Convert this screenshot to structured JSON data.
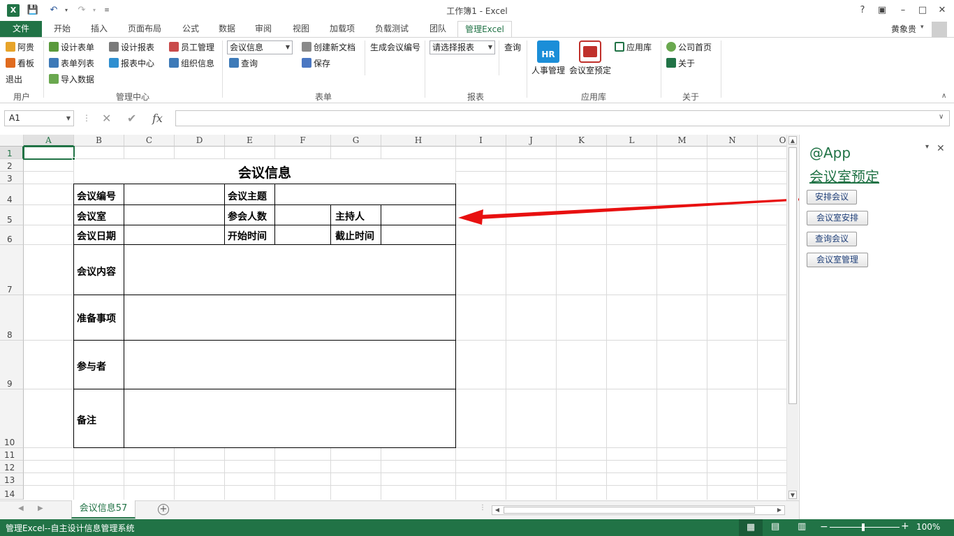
{
  "window": {
    "title": "工作簿1 - Excel",
    "help": "?",
    "user": "黄象贵"
  },
  "tabs": [
    "文件",
    "开始",
    "插入",
    "页面布局",
    "公式",
    "数据",
    "审阅",
    "视图",
    "加载项",
    "负载测试",
    "团队",
    "管理Excel"
  ],
  "ribbon": {
    "user_group": {
      "label": "用户",
      "items": [
        "阿贵",
        "看板",
        "退出"
      ]
    },
    "mgmt_group": {
      "label": "管理中心",
      "items": [
        "设计表单",
        "表单列表",
        "导入数据",
        "设计报表",
        "报表中心",
        "员工管理",
        "组织信息"
      ]
    },
    "form_group": {
      "label": "表单",
      "combo": "会议信息",
      "query": "查询",
      "new_doc": "创建新文档",
      "save": "保存",
      "gen_no": "生成会议编号"
    },
    "report_group": {
      "label": "报表",
      "combo": "请选择报表",
      "query": "查询"
    },
    "app_group": {
      "label": "应用库",
      "hr": "人事管理",
      "hr_badge": "HR",
      "meeting": "会议室预定",
      "applib": "应用库"
    },
    "about_group": {
      "label": "关于",
      "home": "公司首页",
      "about": "关于"
    }
  },
  "formula_bar": {
    "name_box": "A1",
    "fx": "fx",
    "value": ""
  },
  "grid": {
    "columns": [
      "A",
      "B",
      "C",
      "D",
      "E",
      "F",
      "G",
      "H",
      "I",
      "J",
      "K",
      "L",
      "M",
      "N",
      "O"
    ],
    "rows": [
      "1",
      "2",
      "3",
      "4",
      "5",
      "6",
      "7",
      "8",
      "9",
      "10",
      "11",
      "12",
      "13",
      "14"
    ],
    "title": "会议信息",
    "labels": {
      "no": "会议编号",
      "topic": "会议主题",
      "room": "会议室",
      "count": "参会人数",
      "host": "主持人",
      "date": "会议日期",
      "start": "开始时间",
      "end": "截止时间",
      "content": "会议内容",
      "prep": "准备事项",
      "attendees": "参与者",
      "note": "备注"
    }
  },
  "sheet_tabs": {
    "active": "会议信息57",
    "add": "+"
  },
  "status_bar": {
    "text": "管理Excel--自主设计信息管理系统",
    "zoom": "100%",
    "minus": "−",
    "plus": "+"
  },
  "pane": {
    "app": "@App",
    "title": "会议室预定",
    "buttons": [
      "安排会议",
      "会议室安排",
      "查询会议",
      "会议室管理"
    ]
  },
  "colors": {
    "accent": "#217346",
    "arrow": "#e81010"
  }
}
